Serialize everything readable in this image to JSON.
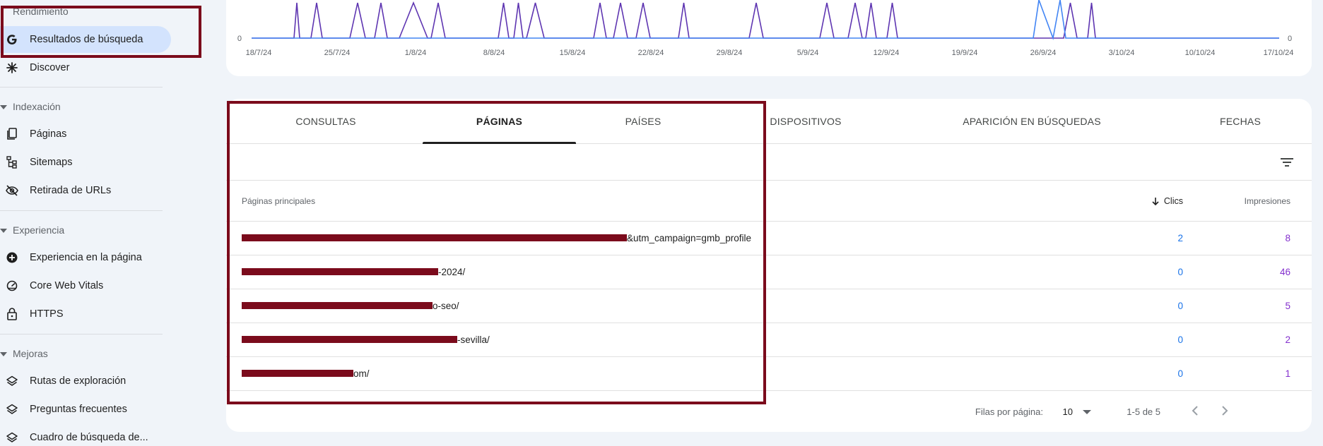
{
  "sidebar": {
    "sections": {
      "rendimiento": "Rendimiento",
      "indexacion": "Indexación",
      "experiencia": "Experiencia",
      "mejoras": "Mejoras"
    },
    "items": {
      "resultados": "Resultados de búsqueda",
      "discover": "Discover",
      "paginas": "Páginas",
      "sitemaps": "Sitemaps",
      "retirada": "Retirada de URLs",
      "exp_pagina": "Experiencia en la página",
      "core_web_vitals": "Core Web Vitals",
      "https": "HTTPS",
      "rutas": "Rutas de exploración",
      "preguntas": "Preguntas frecuentes",
      "cuadro": "Cuadro de búsqueda de..."
    }
  },
  "chart": {
    "zero_left": "0",
    "zero_right": "0",
    "x_ticks": [
      "18/7/24",
      "25/7/24",
      "1/8/24",
      "8/8/24",
      "15/8/24",
      "22/8/24",
      "29/8/24",
      "5/9/24",
      "12/9/24",
      "19/9/24",
      "26/9/24",
      "3/10/24",
      "10/10/24",
      "17/10/24"
    ],
    "colors": {
      "impressions": "#5e35b1",
      "clicks": "#4285f4"
    }
  },
  "tabs": {
    "consultas": "CONSULTAS",
    "paginas": "PÁGINAS",
    "paises": "PAÍSES",
    "dispositivos": "DISPOSITIVOS",
    "aparicion": "APARICIÓN EN BÚSQUEDAS",
    "fechas": "FECHAS"
  },
  "table": {
    "col_main": "Páginas principales",
    "col_clicks": "Clics",
    "col_impressions": "Impresiones",
    "rows": [
      {
        "url_visible": "&utm_campaign=gmb_profile",
        "clicks": "2",
        "impressions": "8"
      },
      {
        "url_visible": "-2024/",
        "clicks": "0",
        "impressions": "46"
      },
      {
        "url_visible": "o-seo/",
        "clicks": "0",
        "impressions": "5"
      },
      {
        "url_visible": "-sevilla/",
        "clicks": "0",
        "impressions": "2"
      },
      {
        "url_visible": "om/",
        "clicks": "0",
        "impressions": "1"
      }
    ]
  },
  "pager": {
    "rows_label": "Filas por página:",
    "rows_value": "10",
    "range": "1-5 de 5"
  }
}
